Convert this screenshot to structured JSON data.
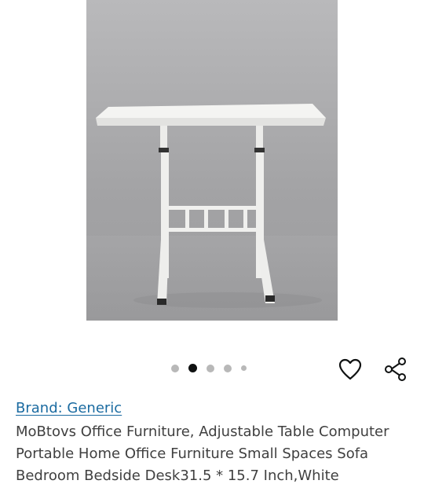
{
  "product": {
    "brand_link": "Brand: Generic",
    "title": "MoBtovs Office Furniture, Adjustable Table Computer Portable Home Office Furniture Small Spaces Sofa Bedroom Bedside Desk31.5 * 15.7 Inch,White"
  },
  "carousel": {
    "total_dots": 5,
    "active_index": 1
  },
  "icons": {
    "favorite": "heart-icon",
    "share": "share-icon"
  },
  "colors": {
    "link": "#1b6ba1",
    "text": "#404040",
    "dot_active": "#0f1111",
    "dot_inactive": "#b8b8b8"
  }
}
